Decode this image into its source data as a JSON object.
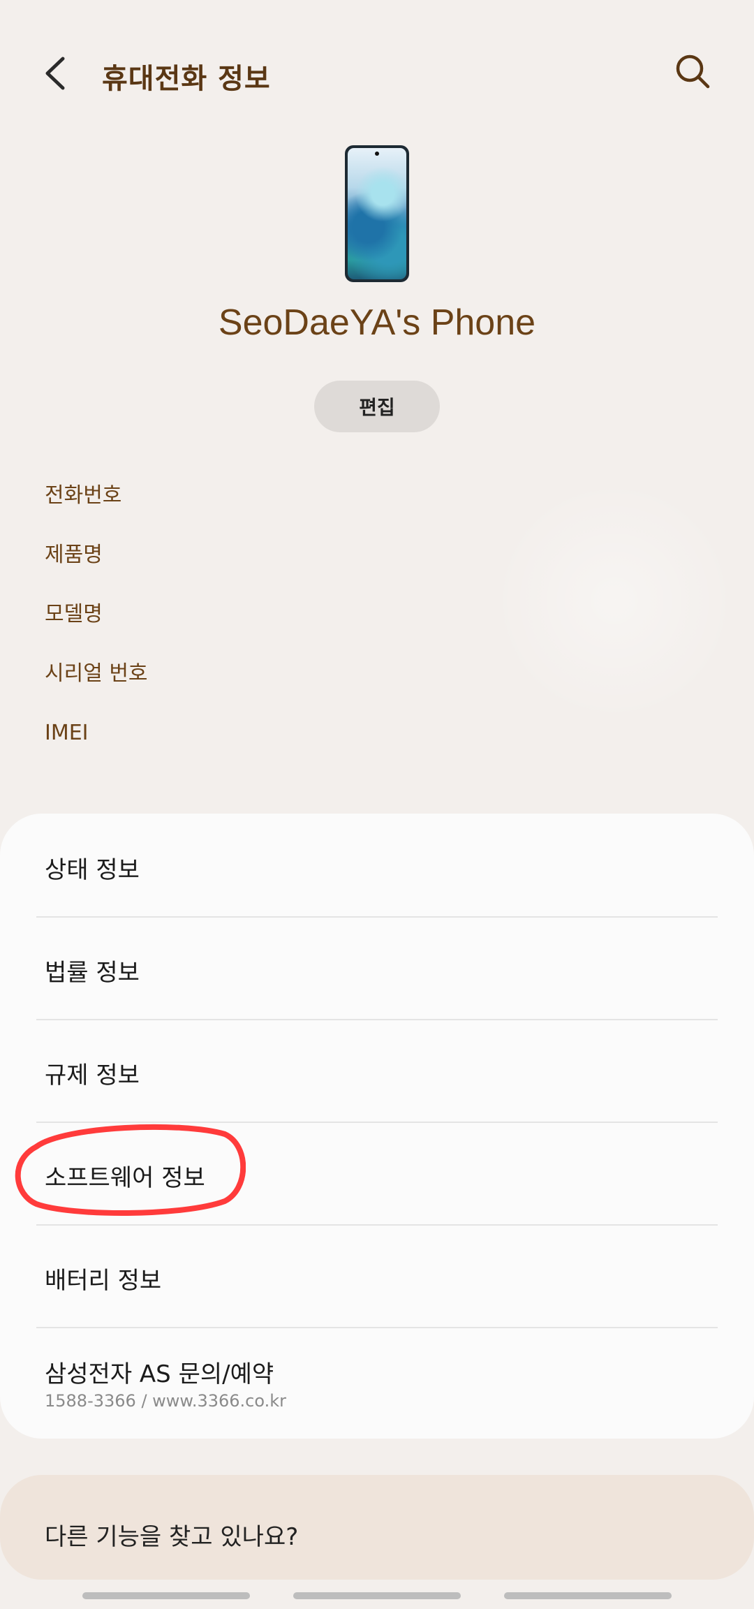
{
  "header": {
    "title": "휴대전화 정보"
  },
  "device": {
    "name": "SeoDaeYA's Phone",
    "edit_label": "편집"
  },
  "info_items": [
    {
      "label": "전화번호"
    },
    {
      "label": "제품명"
    },
    {
      "label": "모델명"
    },
    {
      "label": "시리얼 번호"
    },
    {
      "label": "IMEI"
    }
  ],
  "menu": [
    {
      "label": "상태 정보"
    },
    {
      "label": "법률 정보"
    },
    {
      "label": "규제 정보"
    },
    {
      "label": "소프트웨어 정보"
    },
    {
      "label": "배터리 정보"
    },
    {
      "label": "삼성전자 AS 문의/예약",
      "sub": "1588-3366 / www.3366.co.kr"
    }
  ],
  "footer": {
    "label": "다른 기능을 찾고 있나요?"
  },
  "icons": {
    "back": "back-arrow-icon",
    "search": "search-icon"
  },
  "colors": {
    "accent": "#6b4217",
    "highlight": "#ff3b3b",
    "background": "#f3efec"
  }
}
